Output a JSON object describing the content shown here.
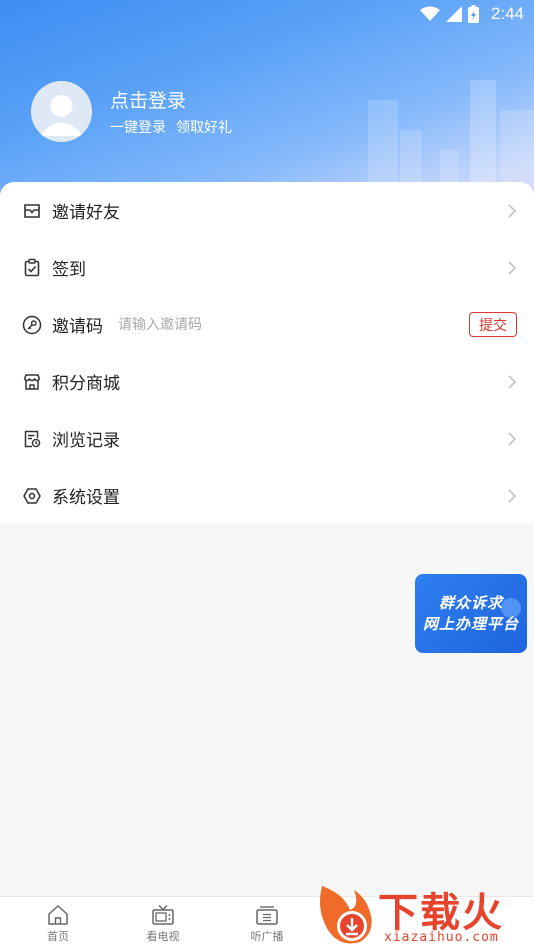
{
  "status_bar": {
    "time": "2:44"
  },
  "profile": {
    "title": "点击登录",
    "subtitle_left": "一键登录",
    "subtitle_right": "领取好礼"
  },
  "menu": {
    "items": [
      {
        "label": "邀请好友",
        "icon": "envelope-icon"
      },
      {
        "label": "签到",
        "icon": "clipboard-check-icon"
      },
      {
        "label": "邀请码",
        "icon": "key-icon",
        "placeholder": "请输入邀请码",
        "value": "",
        "action": "提交"
      },
      {
        "label": "积分商城",
        "icon": "store-icon"
      },
      {
        "label": "浏览记录",
        "icon": "history-icon"
      },
      {
        "label": "系统设置",
        "icon": "settings-hexagon-icon"
      }
    ]
  },
  "promo": {
    "line1": "群众诉求",
    "line2": "网上办理平台"
  },
  "tabs": [
    {
      "label": "首页",
      "icon": "home-icon"
    },
    {
      "label": "看电视",
      "icon": "tv-icon"
    },
    {
      "label": "听广播",
      "icon": "radio-icon"
    }
  ],
  "watermark": {
    "title": "下载火",
    "url": "xiazaihuo.com"
  },
  "colors": {
    "accent_red": "#d8382f",
    "header_blue": "#3f8cf3",
    "promo_blue": "#1f64de"
  }
}
